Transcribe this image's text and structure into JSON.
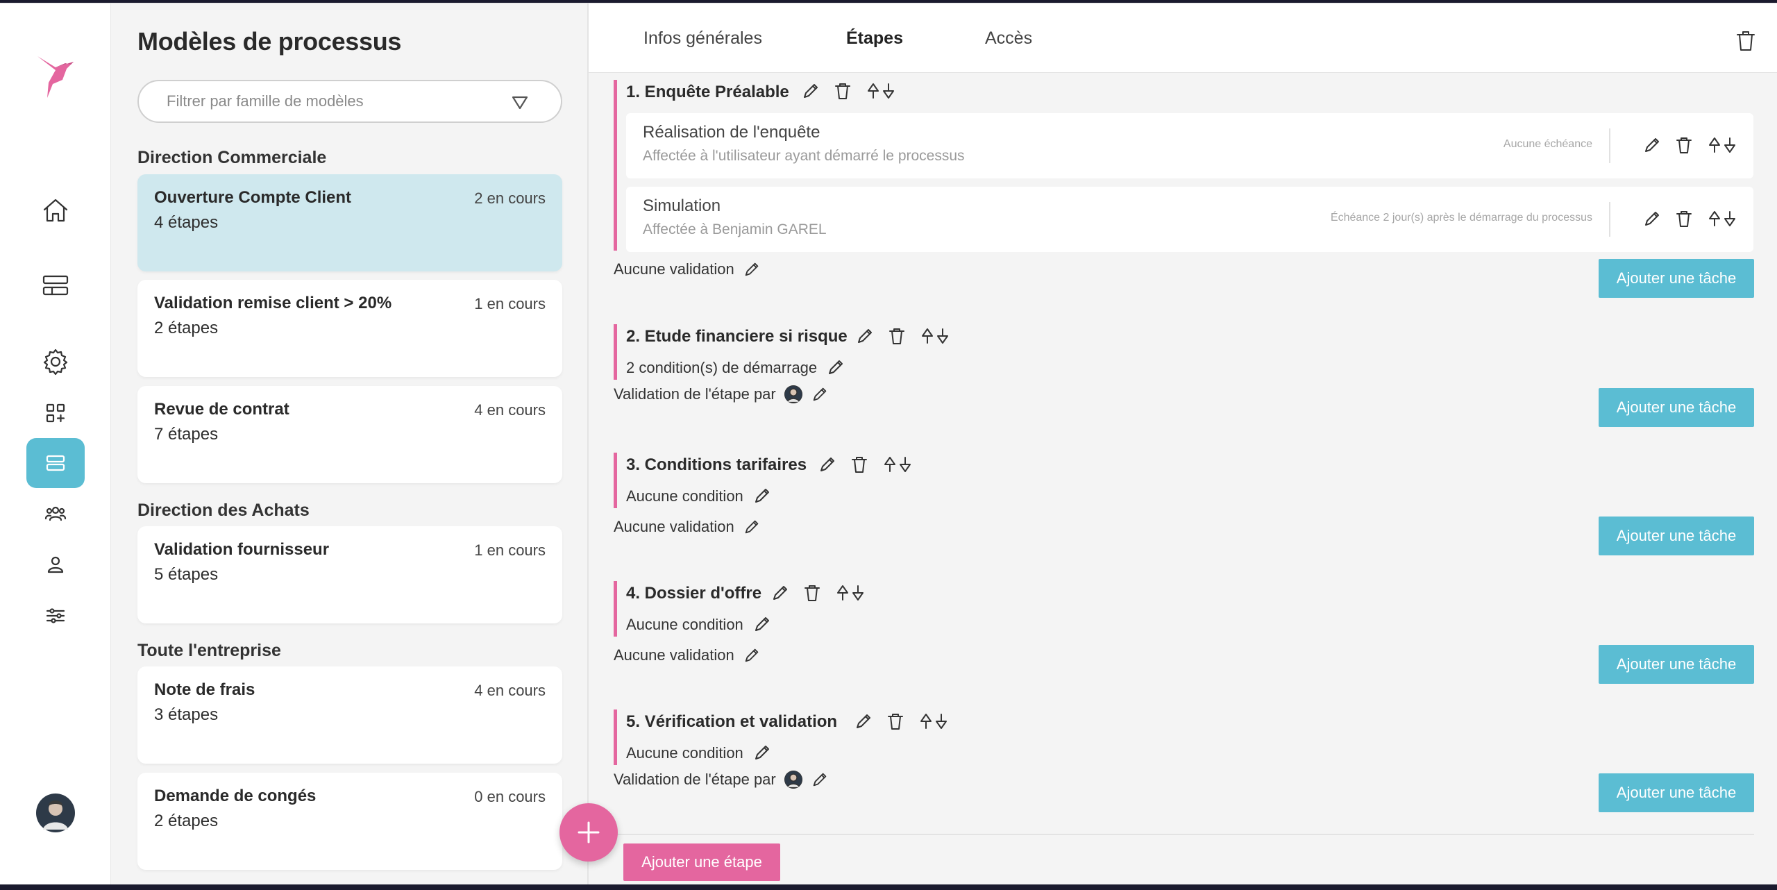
{
  "app": {
    "brand_color": "#e4669f",
    "accent_color": "#5bbdd3"
  },
  "rail": {
    "items": [
      {
        "name": "home-icon"
      },
      {
        "name": "layout-icon"
      },
      {
        "name": "gear-icon"
      },
      {
        "name": "apps-add-icon"
      },
      {
        "name": "process-models-icon",
        "active": true
      },
      {
        "name": "users-group-icon"
      },
      {
        "name": "user-icon"
      },
      {
        "name": "sliders-icon"
      }
    ]
  },
  "list": {
    "title": "Modèles de processus",
    "filter_placeholder": "Filtrer par famille de modèles",
    "groups": [
      {
        "title": "Direction Commerciale",
        "models": [
          {
            "name": "Ouverture Compte Client",
            "steps": "4 étapes",
            "count": "2 en cours",
            "selected": true
          },
          {
            "name": "Validation remise client > 20%",
            "steps": "2 étapes",
            "count": "1 en cours"
          },
          {
            "name": "Revue de contrat",
            "steps": "7 étapes",
            "count": "4 en cours"
          }
        ]
      },
      {
        "title": "Direction des Achats",
        "models": [
          {
            "name": "Validation fournisseur",
            "steps": "5 étapes",
            "count": "1 en cours"
          }
        ]
      },
      {
        "title": "Toute l'entreprise",
        "models": [
          {
            "name": "Note de frais",
            "steps": "3 étapes",
            "count": "4 en cours"
          },
          {
            "name": "Demande de congés",
            "steps": "2 étapes",
            "count": "0 en cours"
          }
        ]
      }
    ]
  },
  "tabs": [
    {
      "label": "Infos générales"
    },
    {
      "label": "Étapes",
      "active": true
    },
    {
      "label": "Accès"
    }
  ],
  "steps": [
    {
      "title": "1. Enquête Préalable",
      "tasks": [
        {
          "name": "Réalisation de l'enquête",
          "assign": "Affectée à l'utilisateur ayant démarré le processus",
          "due": "Aucune échéance"
        },
        {
          "name": "Simulation",
          "assign": "Affectée à Benjamin GAREL",
          "due": "Échéance 2 jour(s) après le démarrage du processus"
        }
      ],
      "validation": "Aucune validation"
    },
    {
      "title": "2. Etude financiere si risque",
      "condition": "2 condition(s) de démarrage",
      "validation": "Validation de l'étape par"
    },
    {
      "title": "3. Conditions tarifaires",
      "condition": "Aucune condition",
      "validation": "Aucune validation"
    },
    {
      "title": "4. Dossier d'offre",
      "condition": "Aucune condition",
      "validation": "Aucune validation"
    },
    {
      "title": "5. Vérification et validation",
      "condition": "Aucune condition",
      "validation": "Validation de l'étape par"
    }
  ],
  "buttons": {
    "add_task": "Ajouter une tâche",
    "add_step": "Ajouter une étape"
  }
}
